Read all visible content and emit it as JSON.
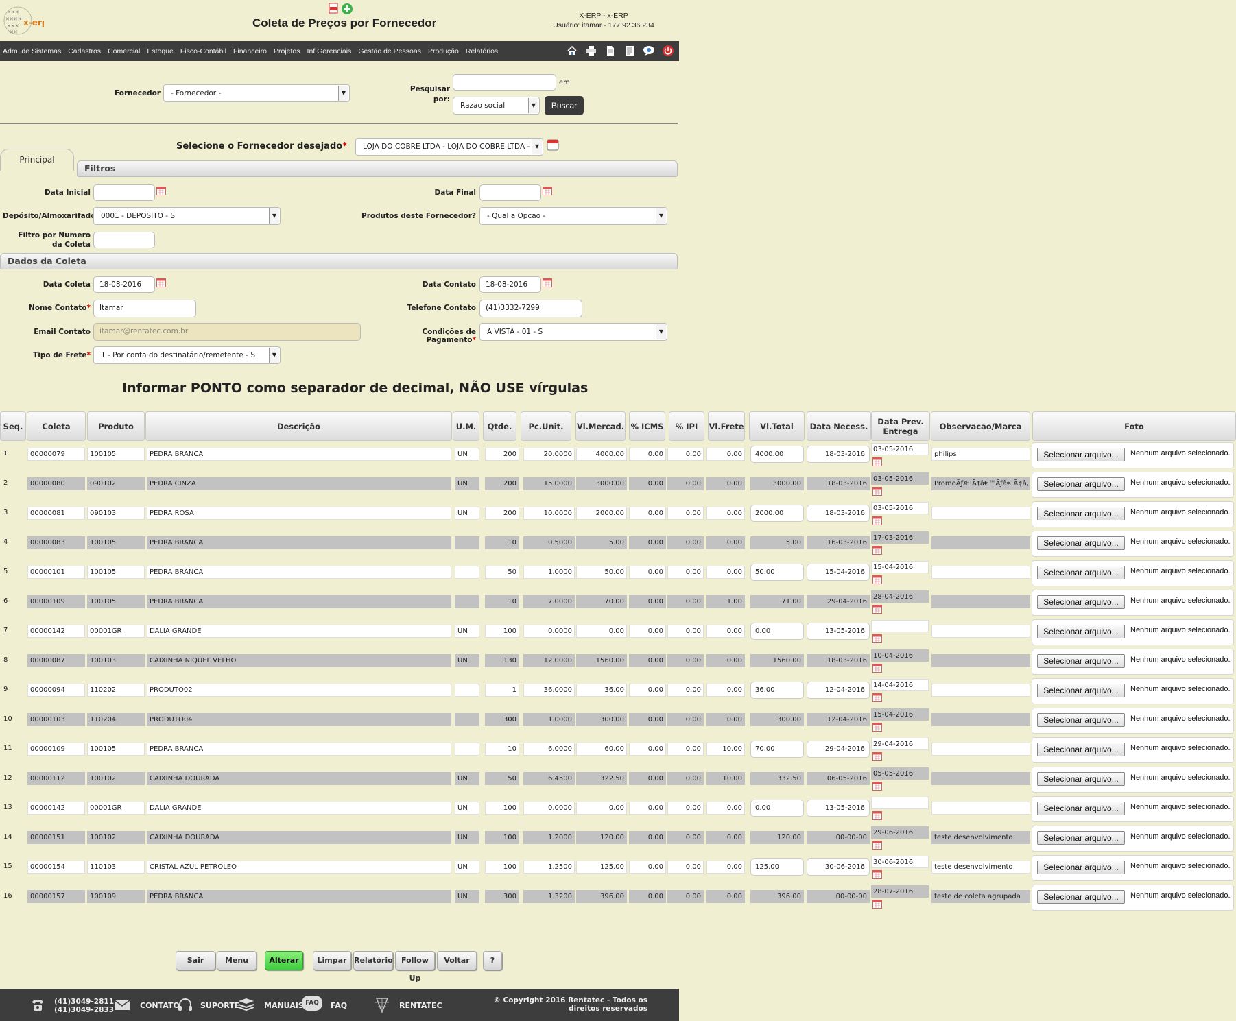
{
  "header": {
    "logo_text": "x-erp",
    "title": "Coleta de Preços por Fornecedor",
    "system": "X-ERP - x-ERP",
    "user": "Usuário: itamar - 177.92.36.234"
  },
  "nav": {
    "menu": [
      "Adm. de Sistemas",
      "Cadastros",
      "Comercial",
      "Estoque",
      "Fisco-Contábil",
      "Financeiro",
      "Projetos",
      "Inf.Gerenciais",
      "Gestão de Pessoas",
      "Produção",
      "Relatórios"
    ],
    "icons": [
      "home-icon",
      "print-icon",
      "document-icon",
      "list-icon",
      "chat-icon",
      "power-icon"
    ]
  },
  "search": {
    "fornecedor_label": "Fornecedor",
    "fornecedor_value": "- Fornecedor -",
    "pesquisar_label": "Pesquisar por:",
    "search_value": "",
    "em_label": "em",
    "field_value": "Razao social",
    "buscar_label": "Buscar"
  },
  "selecione": {
    "label": "Selecione o Fornecedor desejado",
    "value": "LOJA DO COBRE LTDA - LOJA DO COBRE LTDA - C"
  },
  "tabs": {
    "principal": "Principal"
  },
  "filtros": {
    "title": "Filtros",
    "data_inicial_label": "Data Inicial",
    "data_inicial": "",
    "data_final_label": "Data Final",
    "data_final": "",
    "deposito_label": "Depósito/Almoxarifado",
    "deposito": "0001 - DEPOSITO - S",
    "produtos_label": "Produtos deste Fornecedor?",
    "produtos": "- Qual a Opcao -",
    "filtro_numero_label": "Filtro por Numero da Coleta",
    "filtro_numero": ""
  },
  "dados": {
    "title": "Dados da Coleta",
    "data_coleta_label": "Data Coleta",
    "data_coleta": "18-08-2016",
    "data_contato_label": "Data Contato",
    "data_contato": "18-08-2016",
    "nome_contato_label": "Nome Contato",
    "nome_contato": "Itamar",
    "telefone_label": "Telefone Contato",
    "telefone": "(41)3332-7299",
    "email_label": "Email Contato",
    "email": "itamar@rentatec.com.br",
    "condicoes_label": "Condições de Pagamento",
    "condicoes": "A VISTA - 01 - S",
    "frete_label": "Tipo de Frete",
    "frete": "1 - Por conta do destinatário/remetente - S"
  },
  "warning": "Informar PONTO como separador de decimal, NÃO USE vírgulas",
  "table": {
    "columns": [
      "Seq.",
      "Coleta",
      "Produto",
      "Descrição",
      "U.M.",
      "Qtde.",
      "Pc.Unit.",
      "Vl.Mercad.",
      "% ICMS",
      "% IPI",
      "Vl.Frete",
      "Vl.Total",
      "Data Necess.",
      "Data Prev. Entrega",
      "Observacao/Marca",
      "Foto"
    ],
    "foto_button": "Selecionar arquivo...",
    "foto_text": "Nenhum arquivo selecionado.",
    "rows": [
      {
        "seq": "1",
        "coleta": "00000079",
        "produto": "100105",
        "descricao": "PEDRA BRANCA",
        "um": "UN",
        "qtde": "200",
        "pcunit": "20.0000",
        "vlmercad": "4000.00",
        "icms": "0.00",
        "ipi": "0.00",
        "frete": "0.00",
        "total": "4000.00",
        "necess": "18-03-2016",
        "prev": "03-05-2016",
        "obs": "philips"
      },
      {
        "seq": "2",
        "coleta": "00000080",
        "produto": "090102",
        "descricao": "PEDRA CINZA",
        "um": "UN",
        "qtde": "200",
        "pcunit": "15.0000",
        "vlmercad": "3000.00",
        "icms": "0.00",
        "ipi": "0.00",
        "frete": "0.00",
        "total": "3000.00",
        "necess": "18-03-2016",
        "prev": "03-05-2016",
        "obs": "PromoÃƒÆ’Ã†â€™Ãƒâ€ Ã¢â‚"
      },
      {
        "seq": "3",
        "coleta": "00000081",
        "produto": "090103",
        "descricao": "PEDRA ROSA",
        "um": "UN",
        "qtde": "200",
        "pcunit": "10.0000",
        "vlmercad": "2000.00",
        "icms": "0.00",
        "ipi": "0.00",
        "frete": "0.00",
        "total": "2000.00",
        "necess": "18-03-2016",
        "prev": "03-05-2016",
        "obs": ""
      },
      {
        "seq": "4",
        "coleta": "00000083",
        "produto": "100105",
        "descricao": "PEDRA BRANCA",
        "um": "",
        "qtde": "10",
        "pcunit": "0.5000",
        "vlmercad": "5.00",
        "icms": "0.00",
        "ipi": "0.00",
        "frete": "0.00",
        "total": "5.00",
        "necess": "16-03-2016",
        "prev": "17-03-2016",
        "obs": ""
      },
      {
        "seq": "5",
        "coleta": "00000101",
        "produto": "100105",
        "descricao": "PEDRA BRANCA",
        "um": "",
        "qtde": "50",
        "pcunit": "1.0000",
        "vlmercad": "50.00",
        "icms": "0.00",
        "ipi": "0.00",
        "frete": "0.00",
        "total": "50.00",
        "necess": "15-04-2016",
        "prev": "15-04-2016",
        "obs": ""
      },
      {
        "seq": "6",
        "coleta": "00000109",
        "produto": "100105",
        "descricao": "PEDRA BRANCA",
        "um": "",
        "qtde": "10",
        "pcunit": "7.0000",
        "vlmercad": "70.00",
        "icms": "0.00",
        "ipi": "0.00",
        "frete": "1.00",
        "total": "71.00",
        "necess": "29-04-2016",
        "prev": "28-04-2016",
        "obs": ""
      },
      {
        "seq": "7",
        "coleta": "00000142",
        "produto": "00001GR",
        "descricao": "DALIA  GRANDE",
        "um": "UN",
        "qtde": "100",
        "pcunit": "0.0000",
        "vlmercad": "0.00",
        "icms": "0.00",
        "ipi": "0.00",
        "frete": "0.00",
        "total": "0.00",
        "necess": "13-05-2016",
        "prev": "",
        "obs": ""
      },
      {
        "seq": "8",
        "coleta": "00000087",
        "produto": "100103",
        "descricao": "CAIXINHA NIQUEL VELHO",
        "um": "UN",
        "qtde": "130",
        "pcunit": "12.0000",
        "vlmercad": "1560.00",
        "icms": "0.00",
        "ipi": "0.00",
        "frete": "0.00",
        "total": "1560.00",
        "necess": "18-03-2016",
        "prev": "10-04-2016",
        "obs": ""
      },
      {
        "seq": "9",
        "coleta": "00000094",
        "produto": "110202",
        "descricao": "PRODUTO02",
        "um": "",
        "qtde": "1",
        "pcunit": "36.0000",
        "vlmercad": "36.00",
        "icms": "0.00",
        "ipi": "0.00",
        "frete": "0.00",
        "total": "36.00",
        "necess": "12-04-2016",
        "prev": "14-04-2016",
        "obs": ""
      },
      {
        "seq": "10",
        "coleta": "00000103",
        "produto": "110204",
        "descricao": "PRODUTO04",
        "um": "",
        "qtde": "300",
        "pcunit": "1.0000",
        "vlmercad": "300.00",
        "icms": "0.00",
        "ipi": "0.00",
        "frete": "0.00",
        "total": "300.00",
        "necess": "12-04-2016",
        "prev": "15-04-2016",
        "obs": ""
      },
      {
        "seq": "11",
        "coleta": "00000109",
        "produto": "100105",
        "descricao": "PEDRA BRANCA",
        "um": "",
        "qtde": "10",
        "pcunit": "6.0000",
        "vlmercad": "60.00",
        "icms": "0.00",
        "ipi": "0.00",
        "frete": "10.00",
        "total": "70.00",
        "necess": "29-04-2016",
        "prev": "29-04-2016",
        "obs": ""
      },
      {
        "seq": "12",
        "coleta": "00000112",
        "produto": "100102",
        "descricao": "CAIXINHA DOURADA",
        "um": "UN",
        "qtde": "50",
        "pcunit": "6.4500",
        "vlmercad": "322.50",
        "icms": "0.00",
        "ipi": "0.00",
        "frete": "10.00",
        "total": "332.50",
        "necess": "06-05-2016",
        "prev": "05-05-2016",
        "obs": ""
      },
      {
        "seq": "13",
        "coleta": "00000142",
        "produto": "00001GR",
        "descricao": "DALIA  GRANDE",
        "um": "UN",
        "qtde": "100",
        "pcunit": "0.0000",
        "vlmercad": "0.00",
        "icms": "0.00",
        "ipi": "0.00",
        "frete": "0.00",
        "total": "0.00",
        "necess": "13-05-2016",
        "prev": "",
        "obs": ""
      },
      {
        "seq": "14",
        "coleta": "00000151",
        "produto": "100102",
        "descricao": "CAIXINHA DOURADA",
        "um": "UN",
        "qtde": "100",
        "pcunit": "1.2000",
        "vlmercad": "120.00",
        "icms": "0.00",
        "ipi": "0.00",
        "frete": "0.00",
        "total": "120.00",
        "necess": "00-00-00",
        "prev": "29-06-2016",
        "obs": "teste desenvolvimento"
      },
      {
        "seq": "15",
        "coleta": "00000154",
        "produto": "110103",
        "descricao": "CRISTAL AZUL PETROLEO",
        "um": "UN",
        "qtde": "100",
        "pcunit": "1.2500",
        "vlmercad": "125.00",
        "icms": "0.00",
        "ipi": "0.00",
        "frete": "0.00",
        "total": "125.00",
        "necess": "30-06-2016",
        "prev": "30-06-2016",
        "obs": "teste desenvolvimento"
      },
      {
        "seq": "16",
        "coleta": "00000157",
        "produto": "100109",
        "descricao": "PEDRA BRANCA",
        "um": "UN",
        "qtde": "300",
        "pcunit": "1.3200",
        "vlmercad": "396.00",
        "icms": "0.00",
        "ipi": "0.00",
        "frete": "0.00",
        "total": "396.00",
        "necess": "00-00-00",
        "prev": "28-07-2016",
        "obs": "teste de coleta agrupada"
      }
    ]
  },
  "actions": [
    "Sair",
    "Menu",
    "Alterar",
    "Limpar",
    "Relatório",
    "Follow Up",
    "Voltar",
    "?"
  ],
  "footer": {
    "phone1": "(41)3049-2811",
    "phone2": "(41)3049-2833",
    "contato": "CONTATO",
    "suporte": "SUPORTE",
    "manuais": "MANUAIS",
    "faq_badge": "FAQ",
    "faq": "FAQ",
    "rentatec": "RENTATEC",
    "copyright": "© Copyright 2016 Rentatec - Todos os direitos reservados"
  }
}
